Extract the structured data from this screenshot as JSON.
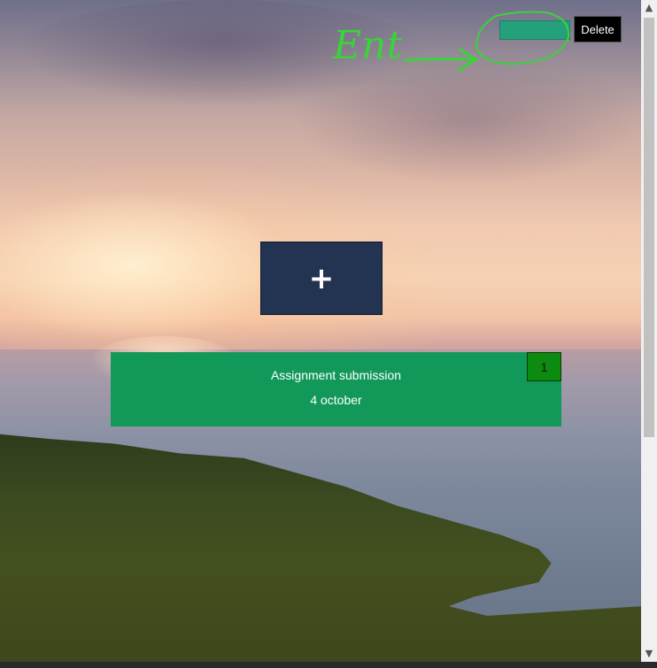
{
  "toolbar": {
    "delete_input_value": "",
    "delete_label": "Delete"
  },
  "annotation": {
    "text": "Ent",
    "color": "#3bd23b"
  },
  "main": {
    "add_label": "+"
  },
  "cards": [
    {
      "title": "Assignment submission",
      "date": "4 october",
      "badge": "1",
      "color": "#12995a"
    }
  ],
  "scrollbar": {
    "up_icon": "chevron-up-icon",
    "down_icon": "chevron-down-icon"
  }
}
